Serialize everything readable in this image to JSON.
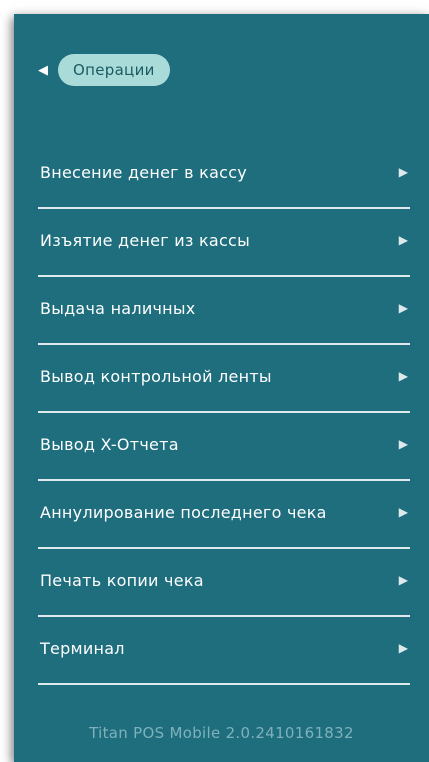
{
  "header": {
    "back_icon": "triangle-left-icon",
    "back_label": "Операции"
  },
  "menu": {
    "items": [
      {
        "label": "Внесение денег в кассу",
        "icon": "triangle-right-icon"
      },
      {
        "label": "Изъятие денег из кассы",
        "icon": "triangle-right-icon"
      },
      {
        "label": "Выдача наличных",
        "icon": "triangle-right-icon"
      },
      {
        "label": "Вывод контрольной ленты",
        "icon": "triangle-right-icon"
      },
      {
        "label": "Вывод X-Отчета",
        "icon": "triangle-right-icon"
      },
      {
        "label": "Аннулирование последнего чека",
        "icon": "triangle-right-icon"
      },
      {
        "label": "Печать копии чека",
        "icon": "triangle-right-icon"
      },
      {
        "label": "Терминал",
        "icon": "triangle-right-icon"
      }
    ]
  },
  "footer": {
    "version": "Titan POS Mobile 2.0.2410161832"
  },
  "colors": {
    "panel_bg": "#1e6e7e",
    "pill_bg": "#a9dcd9",
    "pill_text": "#1c5a64",
    "version_text": "#7fb1bd"
  }
}
